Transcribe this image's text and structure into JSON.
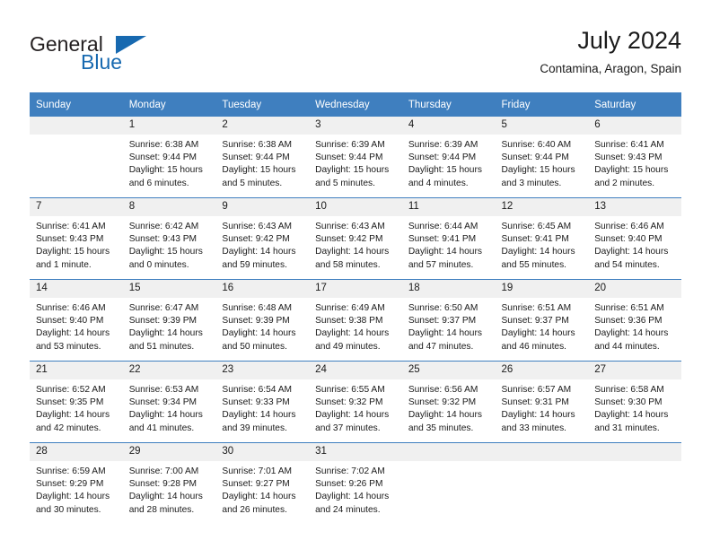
{
  "brand": {
    "line1": "General",
    "line2": "Blue",
    "accent_color": "#1769b0",
    "triangle_icon": "brand-triangle-icon"
  },
  "header": {
    "title": "July 2024",
    "subtitle": "Contamina, Aragon, Spain"
  },
  "calendar": {
    "header_background": "#3f7fbf",
    "daynum_background": "#f0f0f0",
    "weekdays": [
      "Sunday",
      "Monday",
      "Tuesday",
      "Wednesday",
      "Thursday",
      "Friday",
      "Saturday"
    ],
    "weeks": [
      [
        {
          "day": "",
          "blank": true,
          "lines": []
        },
        {
          "day": "1",
          "lines": [
            "Sunrise: 6:38 AM",
            "Sunset: 9:44 PM",
            "Daylight: 15 hours",
            "and 6 minutes."
          ]
        },
        {
          "day": "2",
          "lines": [
            "Sunrise: 6:38 AM",
            "Sunset: 9:44 PM",
            "Daylight: 15 hours",
            "and 5 minutes."
          ]
        },
        {
          "day": "3",
          "lines": [
            "Sunrise: 6:39 AM",
            "Sunset: 9:44 PM",
            "Daylight: 15 hours",
            "and 5 minutes."
          ]
        },
        {
          "day": "4",
          "lines": [
            "Sunrise: 6:39 AM",
            "Sunset: 9:44 PM",
            "Daylight: 15 hours",
            "and 4 minutes."
          ]
        },
        {
          "day": "5",
          "lines": [
            "Sunrise: 6:40 AM",
            "Sunset: 9:44 PM",
            "Daylight: 15 hours",
            "and 3 minutes."
          ]
        },
        {
          "day": "6",
          "lines": [
            "Sunrise: 6:41 AM",
            "Sunset: 9:43 PM",
            "Daylight: 15 hours",
            "and 2 minutes."
          ]
        }
      ],
      [
        {
          "day": "7",
          "lines": [
            "Sunrise: 6:41 AM",
            "Sunset: 9:43 PM",
            "Daylight: 15 hours",
            "and 1 minute."
          ]
        },
        {
          "day": "8",
          "lines": [
            "Sunrise: 6:42 AM",
            "Sunset: 9:43 PM",
            "Daylight: 15 hours",
            "and 0 minutes."
          ]
        },
        {
          "day": "9",
          "lines": [
            "Sunrise: 6:43 AM",
            "Sunset: 9:42 PM",
            "Daylight: 14 hours",
            "and 59 minutes."
          ]
        },
        {
          "day": "10",
          "lines": [
            "Sunrise: 6:43 AM",
            "Sunset: 9:42 PM",
            "Daylight: 14 hours",
            "and 58 minutes."
          ]
        },
        {
          "day": "11",
          "lines": [
            "Sunrise: 6:44 AM",
            "Sunset: 9:41 PM",
            "Daylight: 14 hours",
            "and 57 minutes."
          ]
        },
        {
          "day": "12",
          "lines": [
            "Sunrise: 6:45 AM",
            "Sunset: 9:41 PM",
            "Daylight: 14 hours",
            "and 55 minutes."
          ]
        },
        {
          "day": "13",
          "lines": [
            "Sunrise: 6:46 AM",
            "Sunset: 9:40 PM",
            "Daylight: 14 hours",
            "and 54 minutes."
          ]
        }
      ],
      [
        {
          "day": "14",
          "lines": [
            "Sunrise: 6:46 AM",
            "Sunset: 9:40 PM",
            "Daylight: 14 hours",
            "and 53 minutes."
          ]
        },
        {
          "day": "15",
          "lines": [
            "Sunrise: 6:47 AM",
            "Sunset: 9:39 PM",
            "Daylight: 14 hours",
            "and 51 minutes."
          ]
        },
        {
          "day": "16",
          "lines": [
            "Sunrise: 6:48 AM",
            "Sunset: 9:39 PM",
            "Daylight: 14 hours",
            "and 50 minutes."
          ]
        },
        {
          "day": "17",
          "lines": [
            "Sunrise: 6:49 AM",
            "Sunset: 9:38 PM",
            "Daylight: 14 hours",
            "and 49 minutes."
          ]
        },
        {
          "day": "18",
          "lines": [
            "Sunrise: 6:50 AM",
            "Sunset: 9:37 PM",
            "Daylight: 14 hours",
            "and 47 minutes."
          ]
        },
        {
          "day": "19",
          "lines": [
            "Sunrise: 6:51 AM",
            "Sunset: 9:37 PM",
            "Daylight: 14 hours",
            "and 46 minutes."
          ]
        },
        {
          "day": "20",
          "lines": [
            "Sunrise: 6:51 AM",
            "Sunset: 9:36 PM",
            "Daylight: 14 hours",
            "and 44 minutes."
          ]
        }
      ],
      [
        {
          "day": "21",
          "lines": [
            "Sunrise: 6:52 AM",
            "Sunset: 9:35 PM",
            "Daylight: 14 hours",
            "and 42 minutes."
          ]
        },
        {
          "day": "22",
          "lines": [
            "Sunrise: 6:53 AM",
            "Sunset: 9:34 PM",
            "Daylight: 14 hours",
            "and 41 minutes."
          ]
        },
        {
          "day": "23",
          "lines": [
            "Sunrise: 6:54 AM",
            "Sunset: 9:33 PM",
            "Daylight: 14 hours",
            "and 39 minutes."
          ]
        },
        {
          "day": "24",
          "lines": [
            "Sunrise: 6:55 AM",
            "Sunset: 9:32 PM",
            "Daylight: 14 hours",
            "and 37 minutes."
          ]
        },
        {
          "day": "25",
          "lines": [
            "Sunrise: 6:56 AM",
            "Sunset: 9:32 PM",
            "Daylight: 14 hours",
            "and 35 minutes."
          ]
        },
        {
          "day": "26",
          "lines": [
            "Sunrise: 6:57 AM",
            "Sunset: 9:31 PM",
            "Daylight: 14 hours",
            "and 33 minutes."
          ]
        },
        {
          "day": "27",
          "lines": [
            "Sunrise: 6:58 AM",
            "Sunset: 9:30 PM",
            "Daylight: 14 hours",
            "and 31 minutes."
          ]
        }
      ],
      [
        {
          "day": "28",
          "lines": [
            "Sunrise: 6:59 AM",
            "Sunset: 9:29 PM",
            "Daylight: 14 hours",
            "and 30 minutes."
          ]
        },
        {
          "day": "29",
          "lines": [
            "Sunrise: 7:00 AM",
            "Sunset: 9:28 PM",
            "Daylight: 14 hours",
            "and 28 minutes."
          ]
        },
        {
          "day": "30",
          "lines": [
            "Sunrise: 7:01 AM",
            "Sunset: 9:27 PM",
            "Daylight: 14 hours",
            "and 26 minutes."
          ]
        },
        {
          "day": "31",
          "lines": [
            "Sunrise: 7:02 AM",
            "Sunset: 9:26 PM",
            "Daylight: 14 hours",
            "and 24 minutes."
          ]
        },
        {
          "day": "",
          "blank": true,
          "lines": []
        },
        {
          "day": "",
          "blank": true,
          "lines": []
        },
        {
          "day": "",
          "blank": true,
          "lines": []
        }
      ]
    ]
  }
}
